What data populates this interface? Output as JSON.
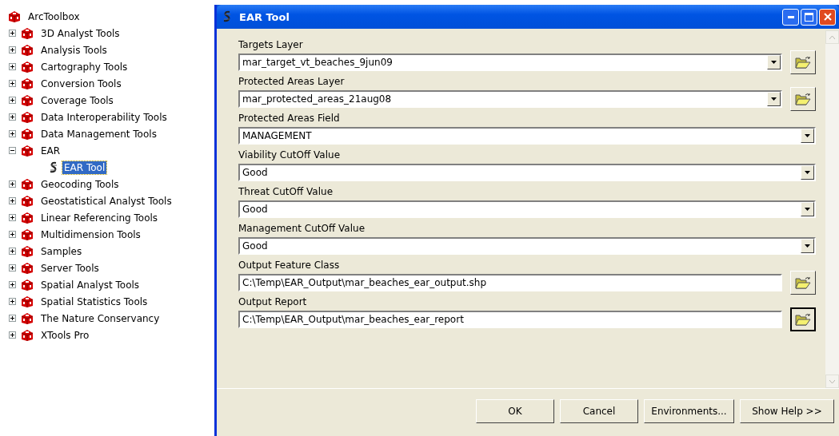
{
  "toolbox_tree": {
    "root": {
      "label": "ArcToolbox"
    },
    "items": [
      {
        "label": "3D Analyst Tools",
        "expanded": false
      },
      {
        "label": "Analysis Tools",
        "expanded": false
      },
      {
        "label": "Cartography Tools",
        "expanded": false
      },
      {
        "label": "Conversion Tools",
        "expanded": false
      },
      {
        "label": "Coverage Tools",
        "expanded": false
      },
      {
        "label": "Data Interoperability Tools",
        "expanded": false
      },
      {
        "label": "Data Management Tools",
        "expanded": false
      },
      {
        "label": "EAR",
        "expanded": true,
        "children": [
          {
            "label": "EAR Tool",
            "selected": true
          }
        ]
      },
      {
        "label": "Geocoding Tools",
        "expanded": false
      },
      {
        "label": "Geostatistical Analyst Tools",
        "expanded": false
      },
      {
        "label": "Linear Referencing Tools",
        "expanded": false
      },
      {
        "label": "Multidimension Tools",
        "expanded": false
      },
      {
        "label": "Samples",
        "expanded": false
      },
      {
        "label": "Server Tools",
        "expanded": false
      },
      {
        "label": "Spatial Analyst Tools",
        "expanded": false
      },
      {
        "label": "Spatial Statistics Tools",
        "expanded": false
      },
      {
        "label": "The Nature Conservancy",
        "expanded": false
      },
      {
        "label": "XTools Pro",
        "expanded": false
      }
    ]
  },
  "window": {
    "title": "EAR Tool"
  },
  "parameters": [
    {
      "label": "Targets Layer",
      "kind": "dropdown-browse",
      "value": "mar_target_vt_beaches_9jun09",
      "focused": false
    },
    {
      "label": "Protected Areas Layer",
      "kind": "dropdown-browse",
      "value": "mar_protected_areas_21aug08",
      "focused": false
    },
    {
      "label": "Protected Areas Field",
      "kind": "dropdown",
      "value": "MANAGEMENT"
    },
    {
      "label": "Viability CutOff Value",
      "kind": "dropdown",
      "value": "Good"
    },
    {
      "label": "Threat CutOff Value",
      "kind": "dropdown",
      "value": "Good"
    },
    {
      "label": "Management CutOff Value",
      "kind": "dropdown",
      "value": "Good"
    },
    {
      "label": "Output Feature Class",
      "kind": "text-browse",
      "value": "C:\\Temp\\EAR_Output\\mar_beaches_ear_output.shp",
      "focused": false
    },
    {
      "label": "Output Report",
      "kind": "text-browse",
      "value": "C:\\Temp\\EAR_Output\\mar_beaches_ear_report",
      "focused": true
    }
  ],
  "buttons": [
    {
      "label": "OK"
    },
    {
      "label": "Cancel"
    },
    {
      "label": "Environments..."
    },
    {
      "label": "Show Help >>"
    }
  ]
}
